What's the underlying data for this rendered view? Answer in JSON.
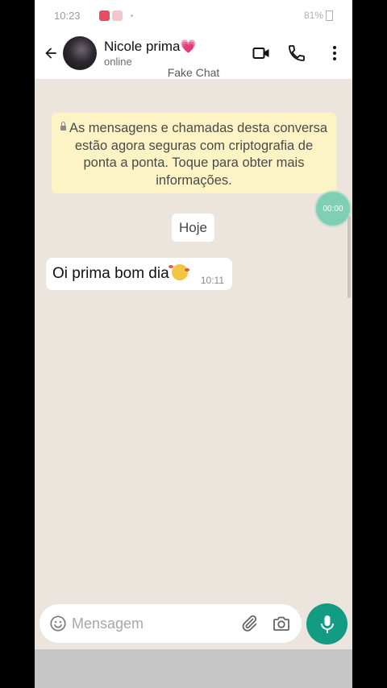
{
  "status_bar": {
    "time": "10:23",
    "battery": "81%"
  },
  "header": {
    "contact_name": "Nicole prima",
    "name_emoji": "💗",
    "presence": "online",
    "watermark": "Fake Chat",
    "icons": [
      "back-arrow-icon",
      "video-call-icon",
      "phone-icon",
      "more-options-icon"
    ]
  },
  "chat": {
    "encryption_notice": "As mensagens e chamadas desta conversa estão agora seguras com criptografia de ponta a ponta. Toque para obter mais informações.",
    "date_chip": "Hoje",
    "recorder_timer": "00:00",
    "messages": [
      {
        "text": "Oi prima bom dia",
        "time": "10:11",
        "direction": "incoming"
      }
    ]
  },
  "input": {
    "placeholder": "Mensagem",
    "icons": [
      "emoji-icon",
      "attach-icon",
      "camera-icon",
      "microphone-icon"
    ]
  },
  "colors": {
    "accent": "#139b83",
    "chat_background": "#ece5dd",
    "encryption_box": "#fdf4c5",
    "timer_bubble": "#7ecfb3"
  }
}
